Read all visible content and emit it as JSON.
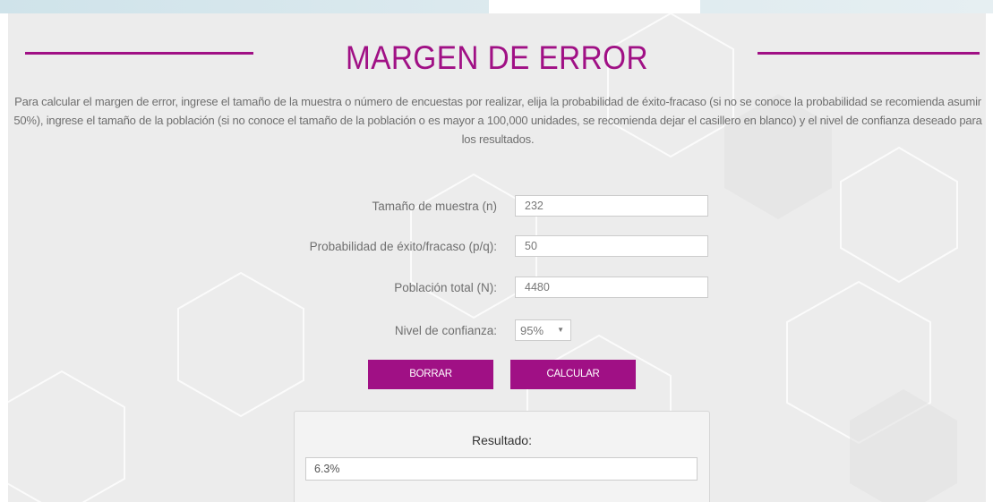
{
  "page": {
    "title": "MARGEN DE ERROR",
    "description": "Para calcular el margen de error, ingrese el tamaño de la muestra o número de encuestas por realizar, elija la probabilidad de éxito-fracaso (si no se conoce la probabilidad se recomienda asumir 50%), ingrese el tamaño de la población (si no conoce el tamaño de la población o es mayor a 100,000 unidades, se recomienda dejar el casillero en blanco) y el nivel de confianza deseado para los resultados."
  },
  "form": {
    "sample_size": {
      "label": "Tamaño de muestra (n)",
      "value": "232"
    },
    "probability": {
      "label": "Probabilidad de éxito/fracaso (p/q):",
      "value": "50"
    },
    "population": {
      "label": "Población total (N):",
      "value": "4480"
    },
    "confidence": {
      "label": "Nivel de confianza:",
      "selected": "95%",
      "arrow_icon": "▼"
    }
  },
  "buttons": {
    "clear": "BORRAR",
    "calculate": "CALCULAR"
  },
  "result": {
    "title": "Resultado:",
    "value": "6.3%"
  },
  "colors": {
    "accent": "#a01085",
    "background": "#ececec",
    "text": "#6f6f6f"
  }
}
